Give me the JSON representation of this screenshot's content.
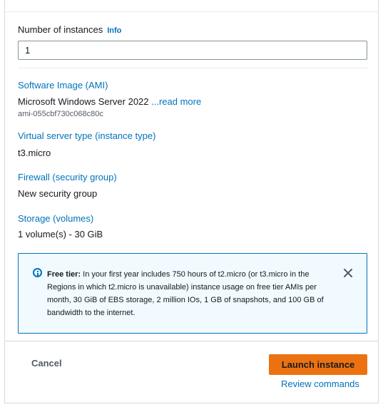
{
  "instances": {
    "label": "Number of instances",
    "info_label": "Info",
    "value": "1"
  },
  "summary": {
    "ami": {
      "title": "Software Image (AMI)",
      "value": "Microsoft Windows Server 2022 ",
      "read_more": "...read more",
      "id": "ami-055cbf730c068c80c"
    },
    "instance_type": {
      "title": "Virtual server type (instance type)",
      "value": "t3.micro"
    },
    "firewall": {
      "title": "Firewall (security group)",
      "value": "New security group"
    },
    "storage": {
      "title": "Storage (volumes)",
      "value": "1 volume(s) - 30 GiB"
    }
  },
  "free_tier_alert": {
    "label": "Free tier:",
    "text": " In your first year includes 750 hours of t2.micro (or t3.micro in the Regions in which t2.micro is unavailable) instance usage on free tier AMIs per month, 30 GiB of EBS storage, 2 million IOs, 1 GB of snapshots, and 100 GB of bandwidth to the internet.",
    "icon": "info-icon",
    "close_icon": "close-icon"
  },
  "footer": {
    "cancel_label": "Cancel",
    "launch_label": "Launch instance",
    "review_label": "Review commands"
  },
  "colors": {
    "link": "#0073bb",
    "primary_button": "#ec7211",
    "alert_border": "#0073bb",
    "alert_background": "#f1faff"
  }
}
